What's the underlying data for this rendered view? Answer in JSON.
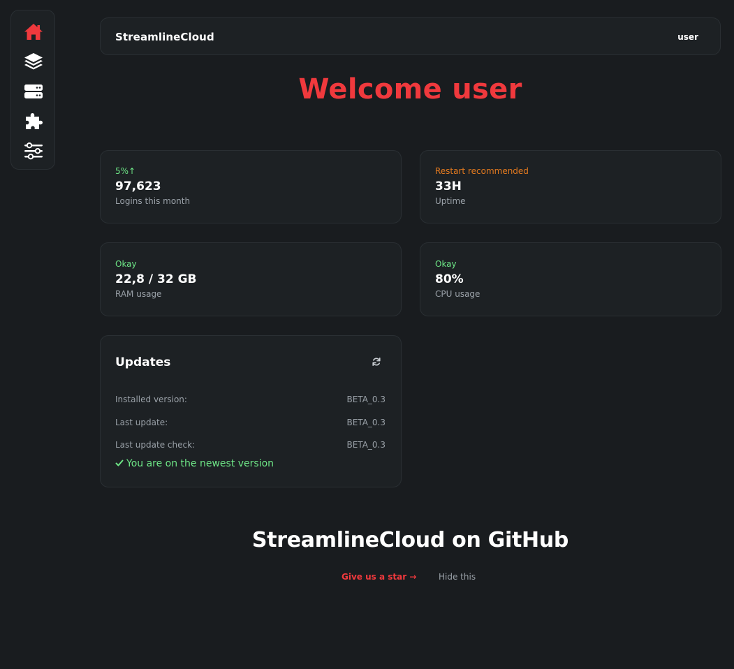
{
  "app": {
    "brand": "StreamlineCloud",
    "user": "user"
  },
  "nav": {
    "items": [
      {
        "icon": "home-icon",
        "active": true
      },
      {
        "icon": "layers-icon",
        "active": false
      },
      {
        "icon": "server-icon",
        "active": false
      },
      {
        "icon": "puzzle-icon",
        "active": false
      },
      {
        "icon": "sliders-icon",
        "active": false
      }
    ]
  },
  "welcome": "Welcome user",
  "stats": [
    {
      "status": "5%↑",
      "value": "97,623",
      "label": "Logins this month",
      "status_color": "#6ee787"
    },
    {
      "status": "Restart recommended",
      "value": "33H",
      "label": "Uptime",
      "status_color": "#e47a1f"
    },
    {
      "status": "Okay",
      "value": "22,8 / 32 GB",
      "label": "RAM usage",
      "status_color": "#6ee787"
    },
    {
      "status": "Okay",
      "value": "80%",
      "label": "CPU usage",
      "status_color": "#6ee787"
    }
  ],
  "updates": {
    "title": "Updates",
    "refresh_icon": "refresh-icon",
    "rows": [
      {
        "label": "Installed version:",
        "value": "BETA_0.3"
      },
      {
        "label": "Last update:",
        "value": "BETA_0.3"
      },
      {
        "label": "Last update check:",
        "value": "BETA_0.3"
      }
    ],
    "status": "You are on the newest version"
  },
  "github": {
    "title": "StreamlineCloud on GitHub",
    "star_label": "Give us a star →",
    "hide_label": "Hide this"
  },
  "colors": {
    "accent": "#f0393d",
    "ok": "#6ee787",
    "warn": "#e47a1f",
    "background": "#191c1f",
    "card": "#1d2124"
  }
}
